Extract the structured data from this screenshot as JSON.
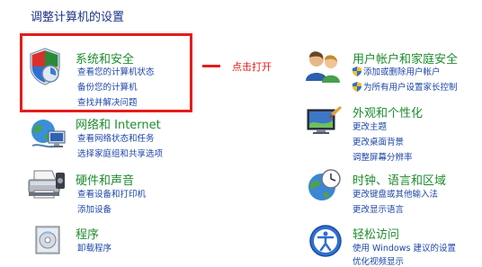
{
  "heading": "调整计算机的设置",
  "annotation": {
    "text": "点击打开"
  },
  "left": [
    {
      "title": "系统和安全",
      "links": [
        "查看您的计算机状态",
        "备份您的计算机",
        "查找并解决问题"
      ]
    },
    {
      "title": "网络和 Internet",
      "links": [
        "查看网络状态和任务",
        "选择家庭组和共享选项"
      ]
    },
    {
      "title": "硬件和声音",
      "links": [
        "查看设备和打印机",
        "添加设备"
      ]
    },
    {
      "title": "程序",
      "links": [
        "卸载程序"
      ]
    }
  ],
  "right": [
    {
      "title": "用户帐户和家庭安全",
      "links": [
        "添加或删除用户帐户",
        "为所有用户设置家长控制"
      ]
    },
    {
      "title": "外观和个性化",
      "links": [
        "更改主题",
        "更改桌面背景",
        "调整屏幕分辨率"
      ]
    },
    {
      "title": "时钟、语言和区域",
      "links": [
        "更改键盘或其他输入法",
        "更改显示语言"
      ]
    },
    {
      "title": "轻松访问",
      "links": [
        "使用 Windows 建议的设置",
        "优化视频显示"
      ]
    }
  ],
  "colors": {
    "title": "#1e8c2e",
    "link": "#1c46a8",
    "heading": "#1e3287",
    "highlight": "#e51c1c"
  }
}
